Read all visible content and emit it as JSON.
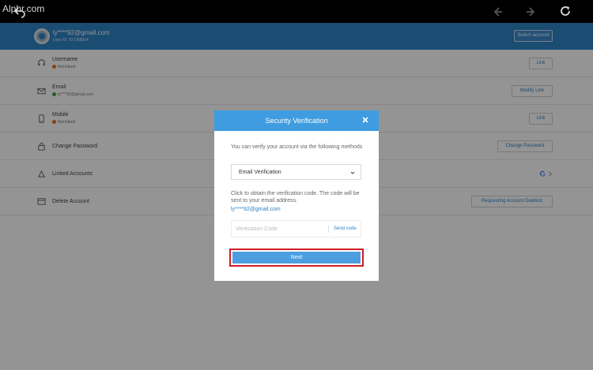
{
  "topbar": {
    "watermark": "Alphr.com"
  },
  "account": {
    "email": "ly****92@gmail.com",
    "user_id": "User ID: 207288924",
    "switch_label": "Switch account"
  },
  "rows": [
    {
      "label": "Username",
      "status": "Not linked",
      "status_color": "#e8711c",
      "action": "Link"
    },
    {
      "label": "Email",
      "status": "ly****92@gmail.com",
      "status_color": "#3aa546",
      "action": "Modify Link"
    },
    {
      "label": "Mobile",
      "status": "Not linked",
      "status_color": "#e8711c",
      "action": "Link"
    },
    {
      "label": "Change Password",
      "action": "Change Password"
    },
    {
      "label": "Linked Accounts"
    },
    {
      "label": "Delete Account",
      "action": "Requesting Account Deletion"
    }
  ],
  "modal": {
    "title": "Security Verification",
    "intro": "You can verify your account via the following methods",
    "method_selected": "Email Verification",
    "description": "Click to obtain the verification code. The code will be sent to your email address.",
    "email": "ly****92@gmail.com",
    "code_placeholder": "Verification Code",
    "send_code": "Send code",
    "next_label": "Next"
  },
  "colors": {
    "header_blue": "#2f83c5",
    "modal_blue": "#3f9ce0",
    "button_blue": "#4c9ee0",
    "highlight_red": "#d11c24"
  }
}
